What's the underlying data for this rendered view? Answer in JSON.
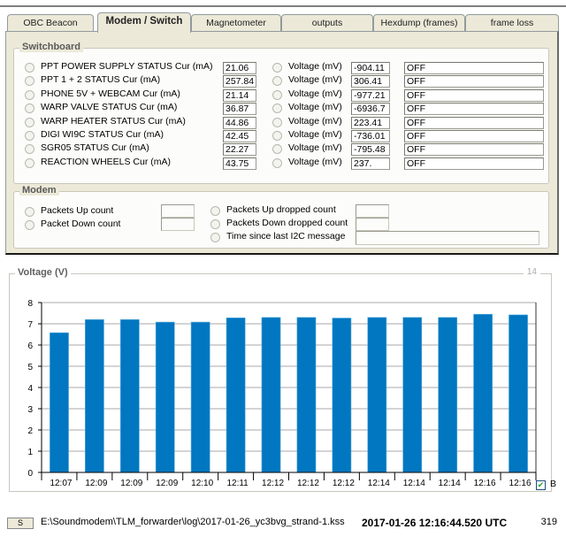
{
  "tabs": [
    {
      "label": "OBC Beacon",
      "active": false
    },
    {
      "label": "Modem / Switch",
      "active": true
    },
    {
      "label": "Magnetometer",
      "active": false
    },
    {
      "label": "outputs",
      "active": false
    },
    {
      "label": "Hexdump (frames)",
      "active": false
    },
    {
      "label": "frame loss",
      "active": false
    }
  ],
  "switchboard": {
    "title": "Switchboard",
    "rows": [
      {
        "label": "PPT POWER SUPPLY STATUS Cur (mA)",
        "current": "21.06",
        "voltage_label": "Voltage (mV)",
        "voltage": "-904.11",
        "state": "OFF"
      },
      {
        "label": "PPT 1 + 2 STATUS Cur (mA)",
        "current": "257.84",
        "voltage_label": "Voltage (mV)",
        "voltage": "306.41",
        "state": "OFF"
      },
      {
        "label": "PHONE 5V + WEBCAM Cur (mA)",
        "current": "21.14",
        "voltage_label": "Voltage (mV)",
        "voltage": "-977.21",
        "state": "OFF"
      },
      {
        "label": "WARP VALVE STATUS Cur (mA)",
        "current": "36.87",
        "voltage_label": "Voltage (mV)",
        "voltage": "-6936.7",
        "state": "OFF"
      },
      {
        "label": "WARP HEATER STATUS Cur (mA)",
        "current": "44.86",
        "voltage_label": "Voltage (mV)",
        "voltage": "223.41",
        "state": "OFF"
      },
      {
        "label": "DIGI WI9C STATUS Cur (mA)",
        "current": "42.45",
        "voltage_label": "Voltage (mV)",
        "voltage": "-736.01",
        "state": "OFF"
      },
      {
        "label": "SGR05 STATUS Cur (mA)",
        "current": "22.27",
        "voltage_label": "Voltage (mV)",
        "voltage": "-795.48",
        "state": "OFF"
      },
      {
        "label": "REACTION WHEELS Cur (mA)",
        "current": "43.75",
        "voltage_label": "Voltage (mV)",
        "voltage": "237.",
        "state": "OFF"
      }
    ]
  },
  "modem": {
    "title": "Modem",
    "left": [
      {
        "label": "Packets Up count",
        "value": ""
      },
      {
        "label": "Packet Down count",
        "value": ""
      }
    ],
    "right": [
      {
        "label": "Packets Up dropped count",
        "value": ""
      },
      {
        "label": "Packets Down dropped count",
        "value": ""
      },
      {
        "label": "Time since last I2C message",
        "value": ""
      }
    ]
  },
  "chart_panel": {
    "title": "Voltage (V)",
    "count": "14",
    "checkbox_label": "B",
    "checkbox_checked": true
  },
  "chart_data": {
    "type": "bar",
    "title": "Voltage (V)",
    "xlabel": "",
    "ylabel": "",
    "categories": [
      "12:07",
      "12:09",
      "12:09",
      "12:09",
      "12:10",
      "12:11",
      "12:12",
      "12:12",
      "12:12",
      "12:14",
      "12:14",
      "12:14",
      "12:16",
      "12:16"
    ],
    "series": [
      {
        "name": "B",
        "color": "#0077c0",
        "values": [
          6.58,
          7.2,
          7.2,
          7.08,
          7.08,
          7.28,
          7.3,
          7.3,
          7.27,
          7.3,
          7.3,
          7.3,
          7.45,
          7.42
        ]
      }
    ],
    "ylim": [
      0,
      8
    ],
    "yticks": [
      0,
      1,
      2,
      3,
      4,
      5,
      6,
      7,
      8
    ],
    "grid": true,
    "legend": "bottom-right"
  },
  "status": {
    "button_label": "S",
    "path": "E:\\Soundmodem\\TLM_forwarder\\log\\2017-01-26_yc3bvg_strand-1.kss",
    "timestamp": "2017-01-26 12:16:44.520 UTC",
    "count": "319"
  }
}
